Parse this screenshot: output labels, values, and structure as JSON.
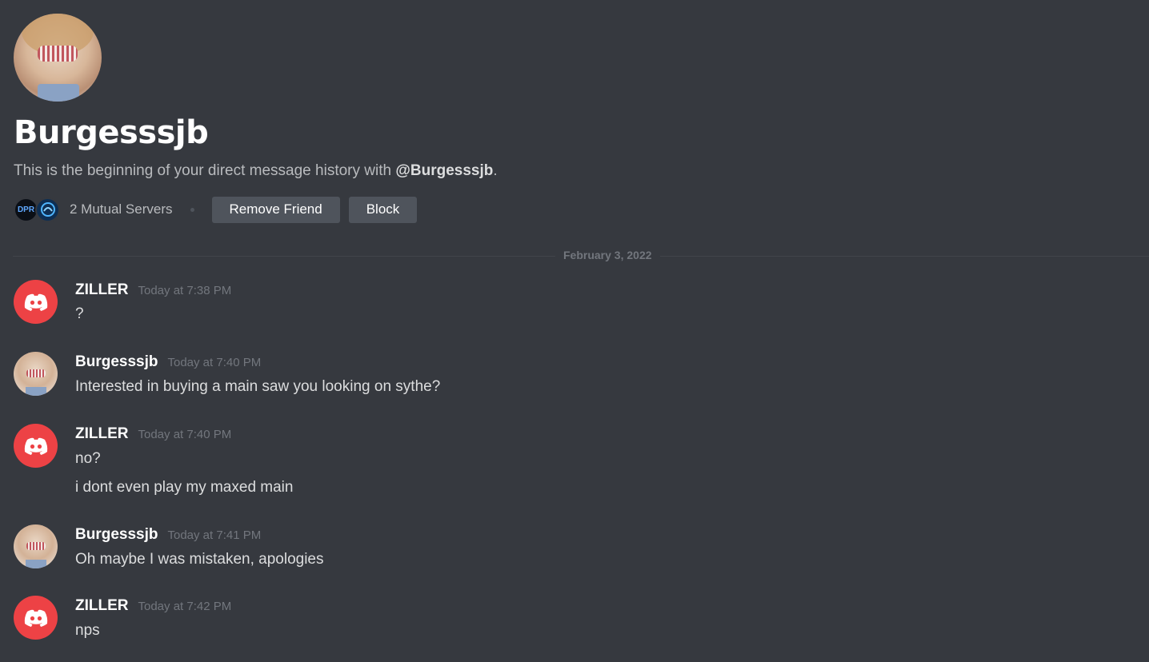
{
  "profile": {
    "name": "Burgesssjb",
    "intro_prefix": "This is the beginning of your direct message history with ",
    "intro_handle": "@Burgesssjb",
    "intro_suffix": ".",
    "servers": [
      {
        "icon": "server-dpr-icon",
        "label": "DPR"
      },
      {
        "icon": "server-blue-icon",
        "label": ""
      }
    ],
    "mutual_servers": "2 Mutual Servers",
    "remove_friend_label": "Remove Friend",
    "block_label": "Block"
  },
  "divider": {
    "date": "February 3, 2022"
  },
  "messages": [
    {
      "author": "ZILLER",
      "time": "Today at 7:38 PM",
      "avatar": "discord-logo-icon",
      "lines": [
        "?"
      ]
    },
    {
      "author": "Burgesssjb",
      "time": "Today at 7:40 PM",
      "avatar": "user-photo",
      "lines": [
        "Interested in buying a main saw you looking on sythe?"
      ]
    },
    {
      "author": "ZILLER",
      "time": "Today at 7:40 PM",
      "avatar": "discord-logo-icon",
      "lines": [
        "no?",
        "i dont even play my maxed main"
      ]
    },
    {
      "author": "Burgesssjb",
      "time": "Today at 7:41 PM",
      "avatar": "user-photo",
      "lines": [
        "Oh maybe I was mistaken, apologies"
      ]
    },
    {
      "author": "ZILLER",
      "time": "Today at 7:42 PM",
      "avatar": "discord-logo-icon",
      "lines": [
        "nps"
      ]
    }
  ],
  "colors": {
    "background": "#36393f",
    "discord_red": "#ed4245",
    "button": "#4f545c",
    "muted_text": "#72767d"
  }
}
